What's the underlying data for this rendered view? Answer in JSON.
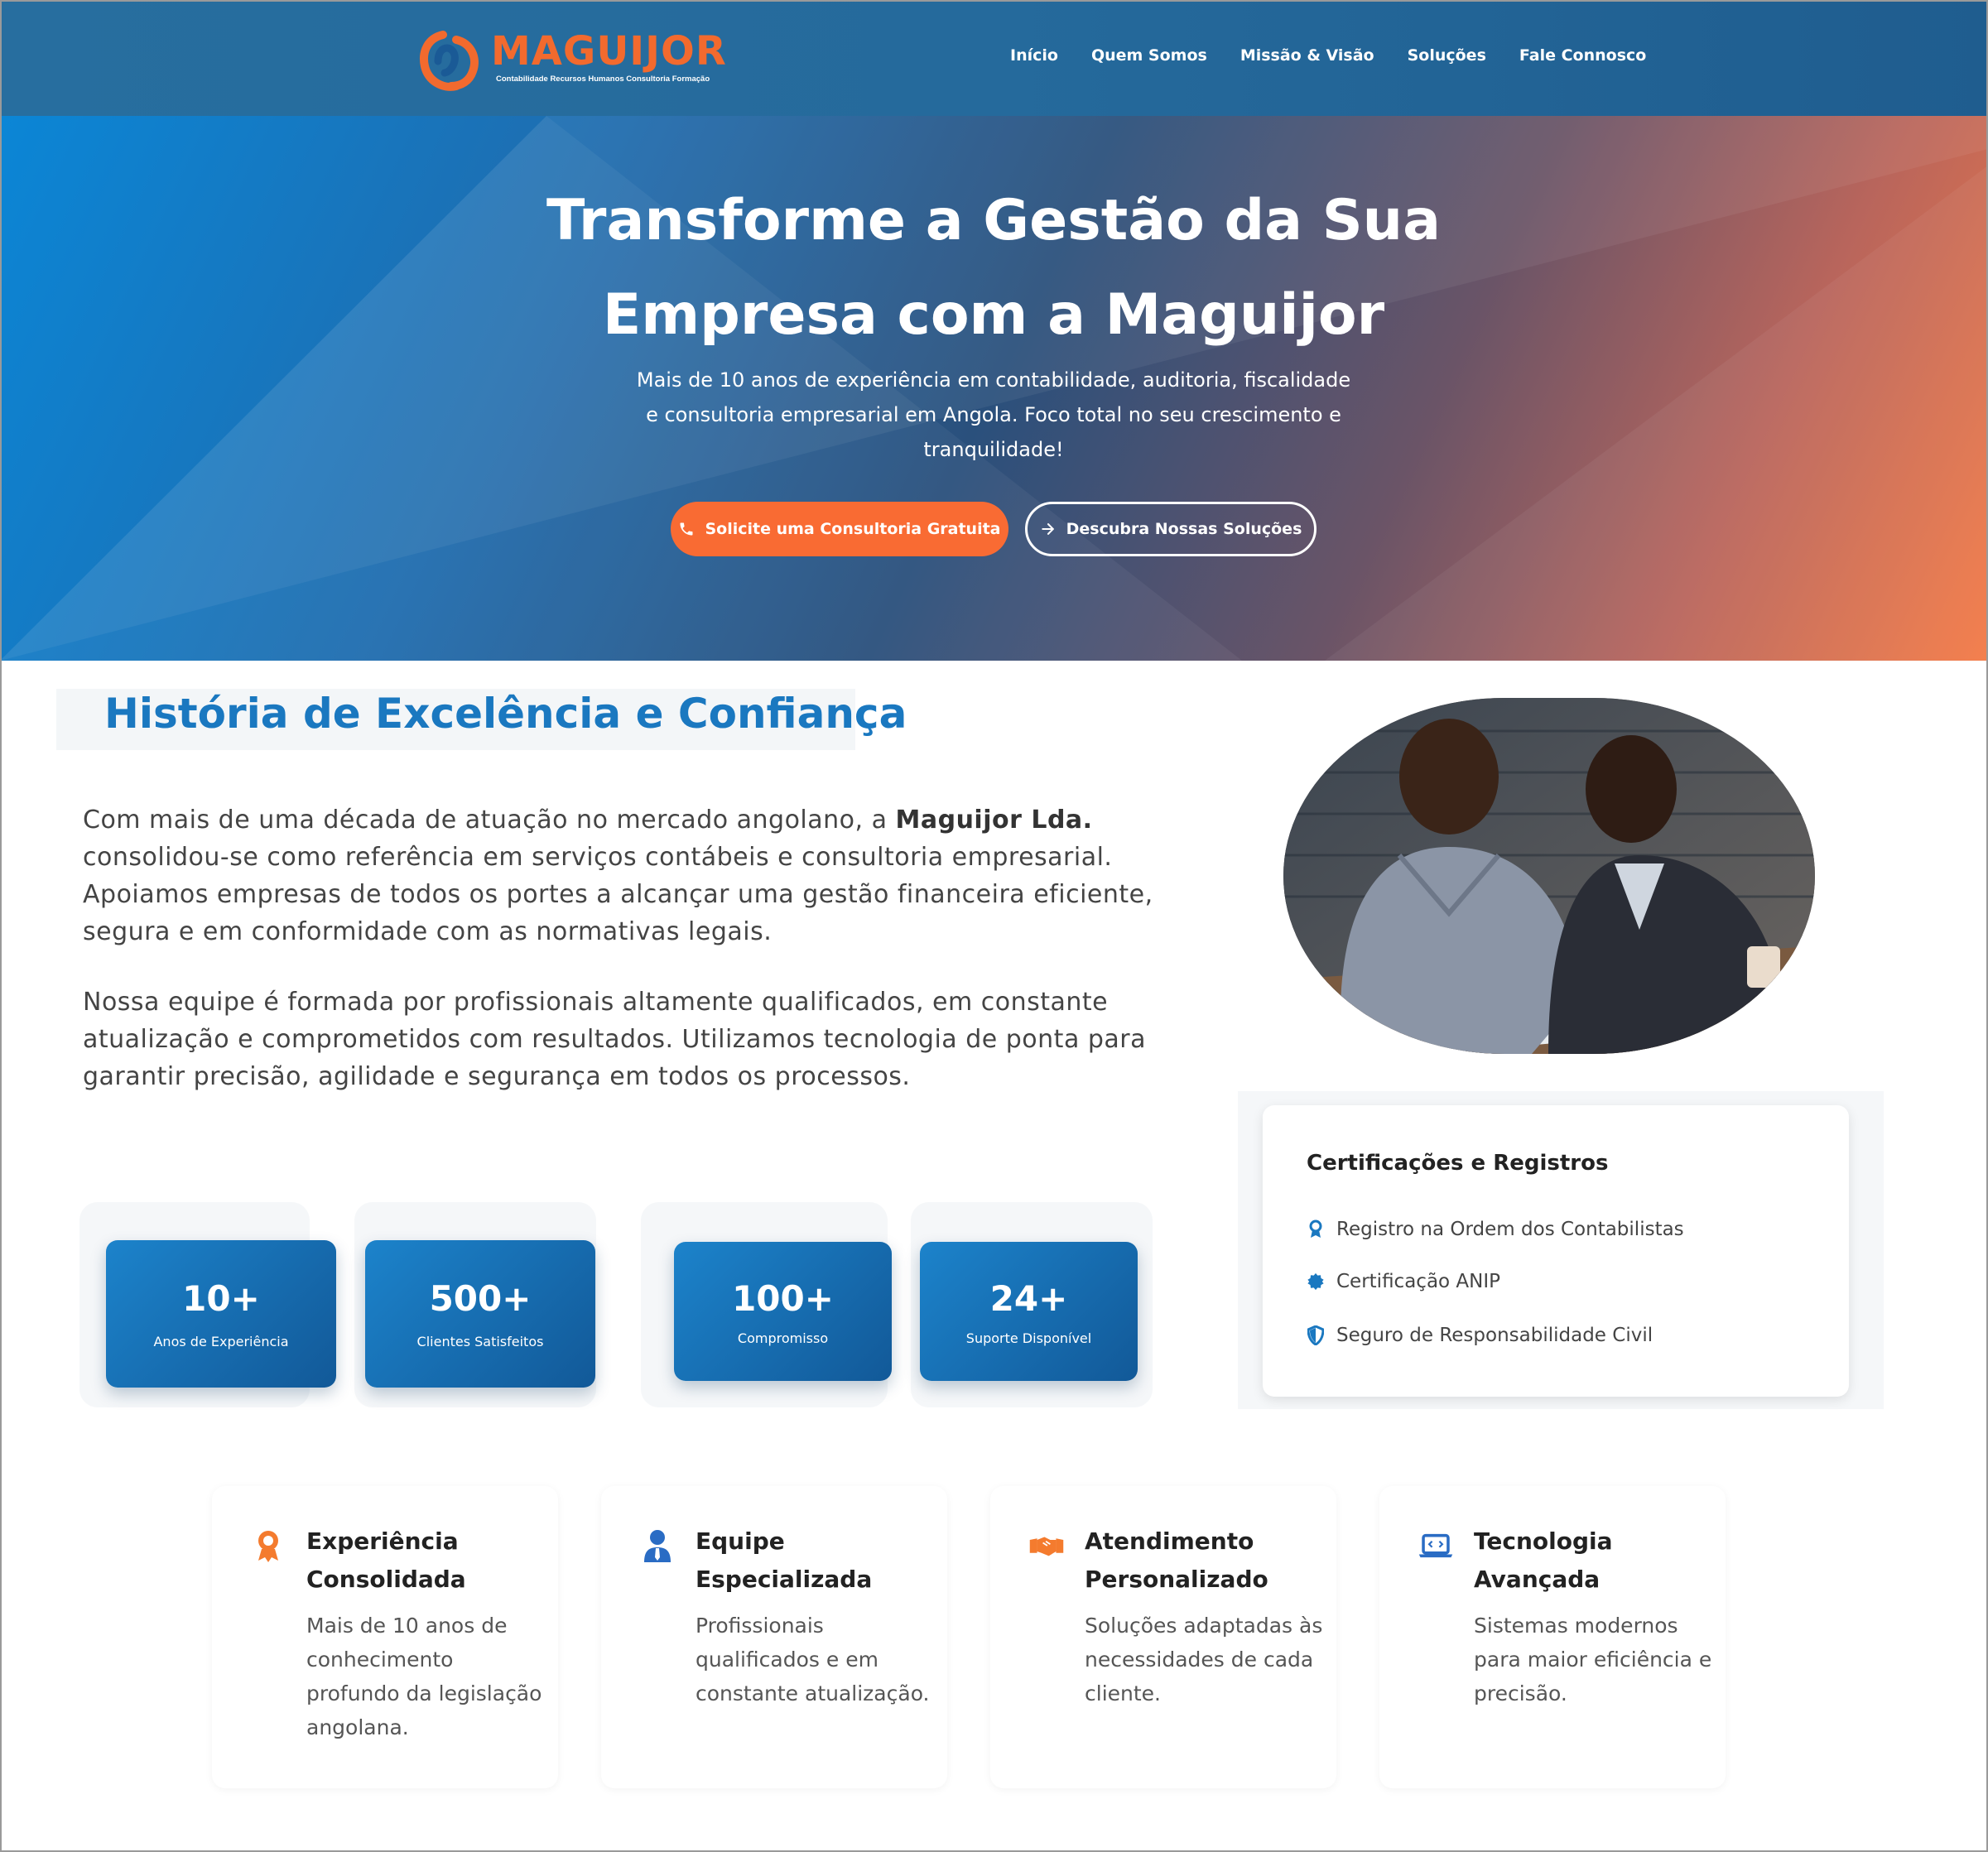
{
  "header": {
    "logo_name": "MAGUIJOR",
    "logo_tagline": "Contabilidade  Recursos Humanos  Consultoria  Formação",
    "nav": [
      "Início",
      "Quem Somos",
      "Missão & Visão",
      "Soluções",
      "Fale Connosco"
    ]
  },
  "hero": {
    "title_line1": "Transforme a Gestão da Sua",
    "title_line2": "Empresa com a Maguijor",
    "subtitle": "Mais de 10 anos de experiência em contabilidade, auditoria, fiscalidade e consultoria empresarial em Angola. Foco total no seu crescimento e tranquilidade!",
    "primary_button": "Solicite uma Consultoria Gratuita",
    "secondary_button": "Descubra Nossas Soluções"
  },
  "history": {
    "title": "História de Excelência e Confiança",
    "p1_start": "Com mais de uma década de atuação no mercado angolano, a ",
    "p1_bold": "Maguijor Lda.",
    "p1_end": " consolidou-se como referência em serviços contábeis e consultoria empresarial. Apoiamos empresas de todos os portes a alcançar uma gestão financeira eficiente, segura e em conformidade com as normativas legais.",
    "p2": "Nossa equipe é formada por profissionais altamente qualificados, em constante atualização e comprometidos com resultados. Utilizamos tecnologia de ponta para garantir precisão, agilidade e segurança em todos os processos."
  },
  "stats": [
    {
      "value": "10+",
      "label": "Anos de Experiência"
    },
    {
      "value": "500+",
      "label": "Clientes Satisfeitos"
    },
    {
      "value": "100+",
      "label": "Compromisso"
    },
    {
      "value": "24+",
      "label": "Suporte Disponível"
    }
  ],
  "certifications": {
    "title": "Certificações e Registros",
    "items": [
      "Registro na Ordem dos Contabilistas",
      "Certificação ANIP",
      "Seguro de Responsabilidade Civil"
    ]
  },
  "features": [
    {
      "title": "Experiência Consolidada",
      "desc": "Mais de 10 anos de conhecimento profundo da legislação angolana.",
      "icon": "award-icon"
    },
    {
      "title": "Equipe Especializada",
      "desc": "Profissionais qualificados e em constante atualização.",
      "icon": "user-tie-icon"
    },
    {
      "title": "Atendimento Personalizado",
      "desc": "Soluções adaptadas às necessidades de cada cliente.",
      "icon": "handshake-icon"
    },
    {
      "title": "Tecnologia Avançada",
      "desc": "Sistemas modernos para maior eficiência e precisão.",
      "icon": "laptop-code-icon"
    }
  ],
  "colors": {
    "brand_orange": "#f96b33",
    "brand_blue": "#1a78c0",
    "header_blue": "#256a9c"
  }
}
